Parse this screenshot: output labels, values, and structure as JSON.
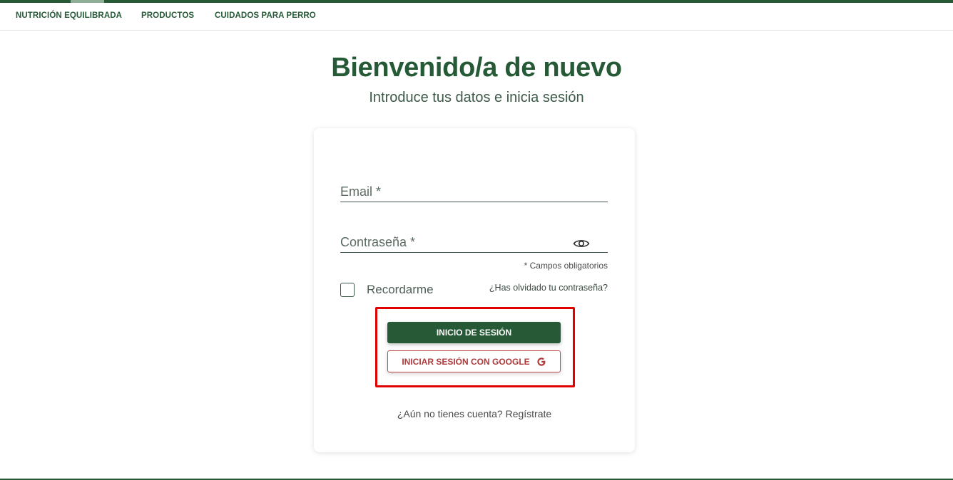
{
  "nav": {
    "items": [
      {
        "label": "NUTRICIÓN EQUILIBRADA"
      },
      {
        "label": "PRODUCTOS"
      },
      {
        "label": "CUIDADOS PARA PERRO"
      }
    ]
  },
  "header": {
    "title": "Bienvenido/a de nuevo",
    "subtitle": "Introduce tus datos e inicia sesión"
  },
  "form": {
    "email": {
      "placeholder": "Email *",
      "value": ""
    },
    "password": {
      "placeholder": "Contraseña *",
      "value": "",
      "toggle_icon": "eye-icon"
    },
    "required_note": "* Campos obligatorios",
    "remember_label": "Recordarme",
    "remember_checked": false,
    "forgot_link": "¿Has olvidado tu contraseña?",
    "login_button": "INICIO DE SESIÓN",
    "google_button": "INICIAR SESIÓN CON GOOGLE",
    "google_icon": "google-icon",
    "signup_prompt": "¿Aún no tienes cuenta?",
    "signup_link": "Regístrate"
  },
  "colors": {
    "brand_green": "#265a36",
    "google_red": "#b1393a",
    "highlight_red": "#e00000"
  }
}
